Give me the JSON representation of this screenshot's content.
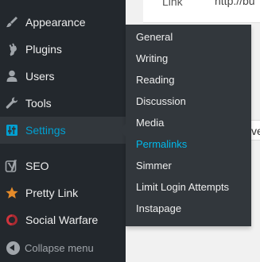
{
  "menu": {
    "items": [
      {
        "label": "Appearance",
        "icon": "paintbrush-icon"
      },
      {
        "label": "Plugins",
        "icon": "plug-icon"
      },
      {
        "label": "Users",
        "icon": "user-icon"
      },
      {
        "label": "Tools",
        "icon": "wrench-icon"
      },
      {
        "label": "Settings",
        "icon": "settings-sliders-icon",
        "current": true
      },
      {
        "label": "SEO",
        "icon": "yoast-seo-icon"
      },
      {
        "label": "Pretty Link",
        "icon": "star-icon"
      },
      {
        "label": "Social Warfare",
        "icon": "social-warfare-icon"
      }
    ],
    "collapse_label": "Collapse menu"
  },
  "settings_submenu": [
    {
      "label": "General"
    },
    {
      "label": "Writing"
    },
    {
      "label": "Reading"
    },
    {
      "label": "Discussion"
    },
    {
      "label": "Media"
    },
    {
      "label": "Permalinks",
      "active": true
    },
    {
      "label": "Simmer"
    },
    {
      "label": "Limit Login Attempts"
    },
    {
      "label": "Instapage"
    }
  ],
  "content": {
    "table_cell_1": "Link",
    "table_cell_2": "http://bu",
    "field_text": "ve"
  },
  "colors": {
    "menu_bg": "#23282d",
    "submenu_bg": "#32373c",
    "accent": "#00a0d2",
    "text": "#eeeeee"
  }
}
